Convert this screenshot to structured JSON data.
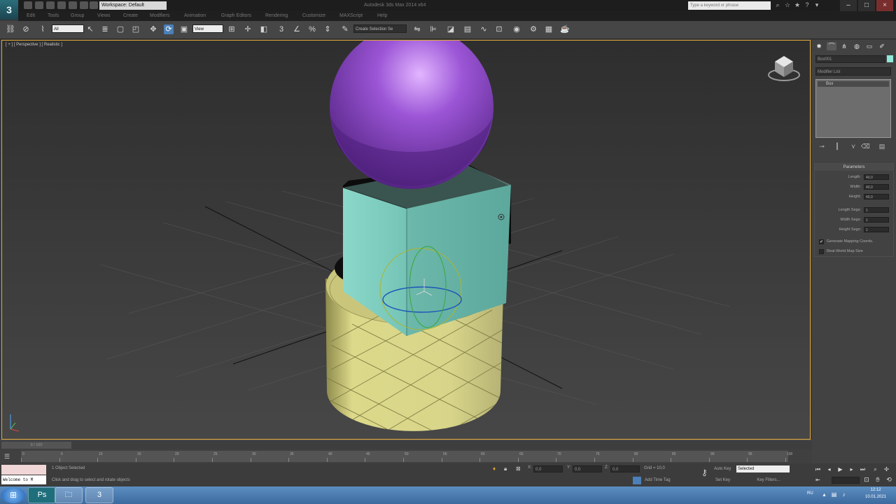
{
  "titlebar": {
    "workspace": "Workspace: Default",
    "app_title": "Autodesk 3ds Max 2014 x64",
    "search_placeholder": "Type a keyword or phrase"
  },
  "menu": [
    "Edit",
    "Tools",
    "Group",
    "Views",
    "Create",
    "Modifiers",
    "Animation",
    "Graph Editors",
    "Rendering",
    "Customize",
    "MAXScript",
    "Help"
  ],
  "toolbar": {
    "filter_value": "All",
    "refcoord_value": "View",
    "selection_set": "Create Selection Se"
  },
  "viewport": {
    "label": "[ + ] [ Perspective ] [ Realistic ]"
  },
  "command_panel": {
    "object_name": "Box001",
    "object_color": "#8fe8d8",
    "modifier_list": "Modifier List",
    "stack_item": "Box",
    "rollout_title": "Parameters",
    "params": [
      {
        "label": "Length:",
        "value": "40,0"
      },
      {
        "label": "Width:",
        "value": "40,0"
      },
      {
        "label": "Height:",
        "value": "40,0"
      },
      {
        "label": "Length Segs:",
        "value": "1"
      },
      {
        "label": "Width Segs:",
        "value": "1"
      },
      {
        "label": "Height Segs:",
        "value": "1"
      }
    ],
    "checks": [
      {
        "label": "Generate Mapping Coords.",
        "checked": true
      },
      {
        "label": "Real-World Map Size",
        "checked": false
      }
    ]
  },
  "timeline": {
    "slider": "0 / 100",
    "ticks": [
      "0",
      "5",
      "10",
      "15",
      "20",
      "25",
      "30",
      "35",
      "40",
      "45",
      "50",
      "55",
      "60",
      "65",
      "70",
      "75",
      "80",
      "85",
      "90",
      "95",
      "100"
    ]
  },
  "status": {
    "maxscript": "Welcome to M",
    "selected": "1 Object Selected",
    "prompt": "Click and drag to select and rotate objects",
    "x_label": "X:",
    "x_value": "0,0",
    "y_label": "Y:",
    "y_value": "0,0",
    "z_label": "Z:",
    "z_value": "0,0",
    "grid": "Grid = 10,0",
    "add_time_tag": "Add Time Tag"
  },
  "keys": {
    "auto_key": "Auto Key",
    "auto_key_value": "Selected",
    "set_key": "Set Key",
    "key_filters": "Key Filters..."
  },
  "taskbar": {
    "lang": "RU",
    "time": "12:12",
    "date": "10.01.2021"
  },
  "colors": {
    "sphere": "#9b55d6",
    "box": "#84d4c6",
    "cylinder": "#dcd98a",
    "viewport_border": "#e0a838"
  }
}
